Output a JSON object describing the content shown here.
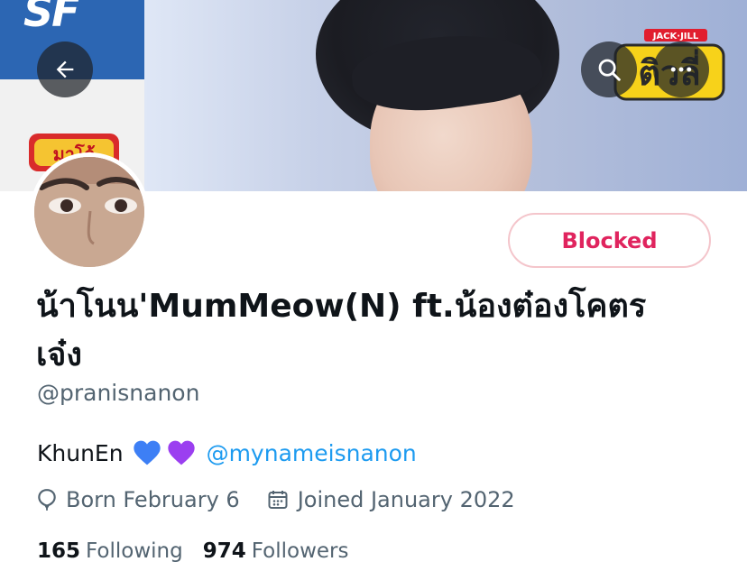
{
  "banner": {
    "sf_logo": "SF",
    "jack_brand": "JACK·JILL",
    "jack_title": "ติวลี่",
    "snack_logo": "มาโจ้"
  },
  "nav": {
    "back_icon": "back-arrow-icon",
    "search_icon": "search-icon",
    "more_icon": "more-dots-icon"
  },
  "profile": {
    "display_name": "น้าโนน'MumMeow(N) ft.น้องต๋องโคตรเจ๋ง",
    "handle": "@pranisnanon",
    "bio_text": "KhunEn",
    "bio_mention": "@mynameisnanon",
    "birthday": "Born February 6",
    "joined": "Joined January 2022",
    "following_count": "165",
    "following_label": "Following",
    "followers_count": "974",
    "followers_label": "Followers"
  },
  "actions": {
    "blocked_label": "Blocked"
  },
  "colors": {
    "accent": "#1d9bf0",
    "blocked": "#e0245e",
    "secondary_text": "#536471",
    "heart_blue": "#3d7ff5",
    "heart_purple": "#9b3ff0"
  }
}
